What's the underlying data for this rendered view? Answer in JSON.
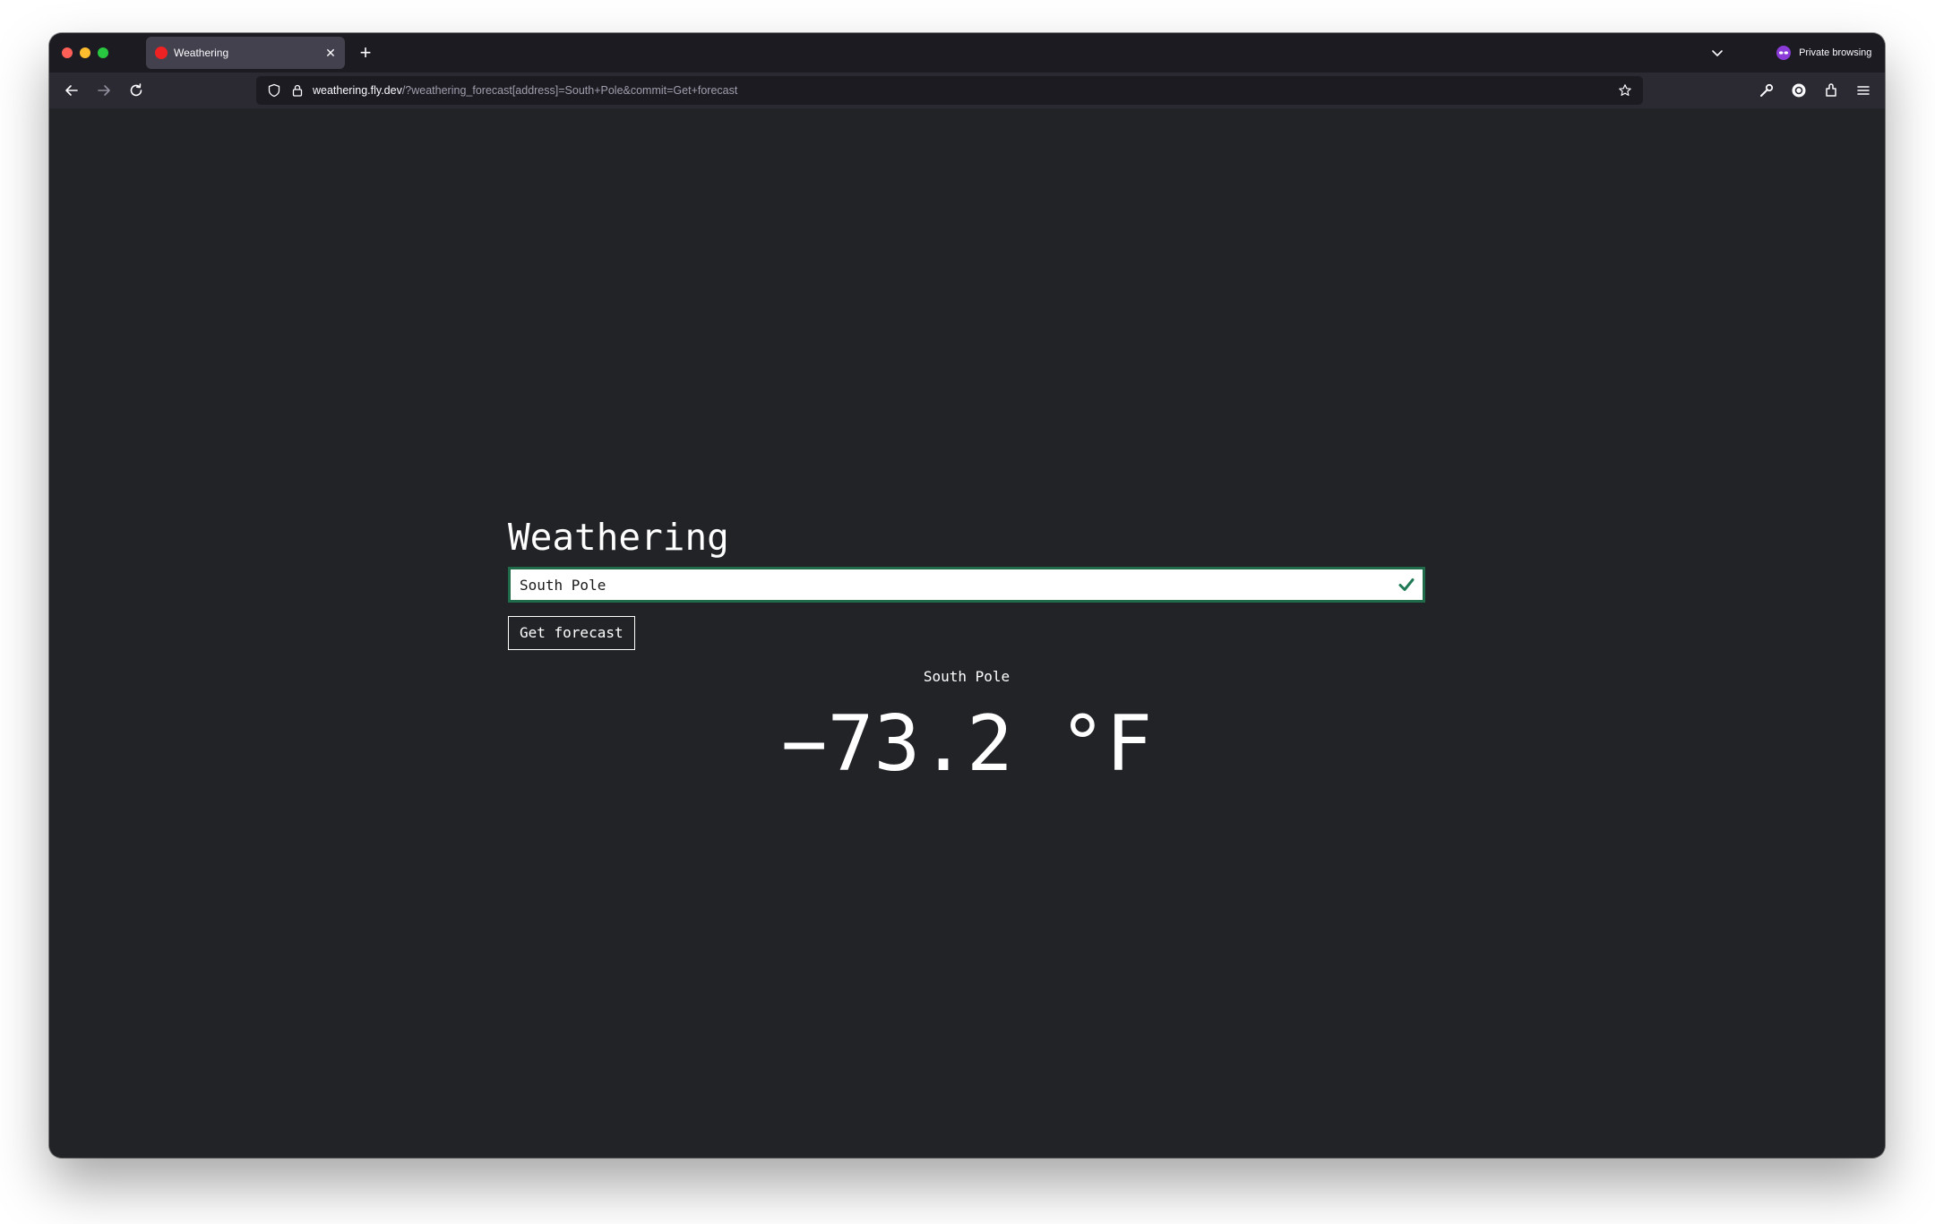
{
  "browser": {
    "tab": {
      "title": "Weathering"
    },
    "private_label": "Private browsing",
    "url": {
      "host": "weathering.fly.dev",
      "path": "/?weathering_forecast[address]=South+Pole&commit=Get+forecast"
    }
  },
  "page": {
    "title": "Weathering",
    "address_input": {
      "value": "South Pole"
    },
    "submit_label": "Get forecast",
    "location": "South Pole",
    "temperature": "−73.2 °F"
  },
  "colors": {
    "page_background": "#212327",
    "input_border_valid": "#1f6b4a",
    "valid_check": "#1f7a55"
  }
}
